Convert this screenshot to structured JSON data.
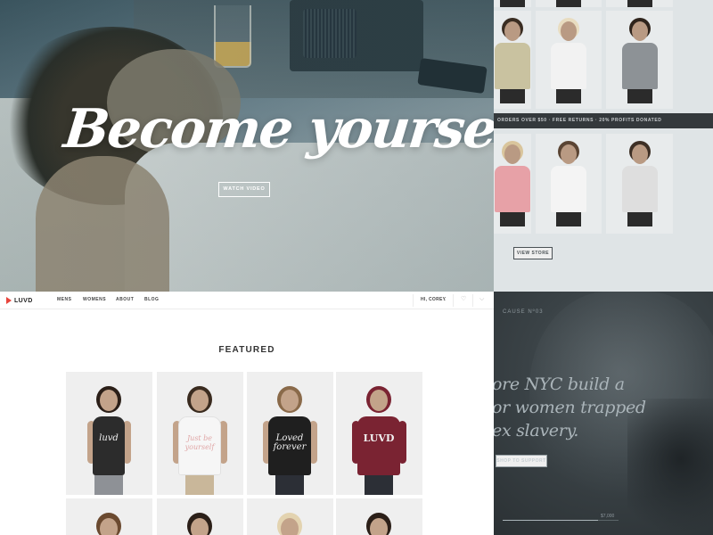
{
  "hero": {
    "headline": "Become yourself",
    "cta_label": "WATCH VIDEO"
  },
  "store": {
    "banner": "ORDERS OVER $50 · FREE RETURNS · 20% PROFITS DONATED",
    "cta_label": "VIEW STORE",
    "products": [
      {
        "name": "store-product-tank-yellow",
        "color": "#c9c2a0"
      },
      {
        "name": "store-product-white-tee",
        "color": "#f2f2f2"
      },
      {
        "name": "store-product-grey-tee",
        "color": "#8d9296"
      },
      {
        "name": "store-product-pink-tee",
        "color": "#e7a1a7"
      },
      {
        "name": "store-product-pocket-tee",
        "color": "#f4f4f4"
      },
      {
        "name": "store-product-live-free-tee",
        "color": "#dedede"
      }
    ]
  },
  "nav": {
    "logo": "LUVD",
    "links": [
      "MENS",
      "WOMENS",
      "ABOUT",
      "BLOG"
    ],
    "user_label": "HI, COREY",
    "icons": [
      "heart-icon",
      "cart-icon",
      "chevron-down-icon"
    ]
  },
  "featured": {
    "title": "FEATURED",
    "cards": [
      {
        "name": "featured-product-black-tank",
        "shirt_color": "#2c2c2c",
        "art": "luvd"
      },
      {
        "name": "featured-product-white-tee-script",
        "shirt_color": "#f6f6f6",
        "art": "Just be yourself"
      },
      {
        "name": "featured-product-black-tee-loved",
        "shirt_color": "#1f1f1f",
        "art": "Loved forever"
      },
      {
        "name": "featured-product-burgundy-hoodie",
        "shirt_color": "#7a2332",
        "art": "LUVD"
      }
    ]
  },
  "cause": {
    "label": "CAUSE Nº03",
    "lines": [
      "ore NYC build a",
      "or women trapped",
      "ex slavery."
    ],
    "cta_label": "SHOP TO SUPPORT",
    "amount": "$7,000",
    "progress": 0.82
  },
  "colors": {
    "accent": "#e8453c",
    "dark": "#34393c"
  }
}
